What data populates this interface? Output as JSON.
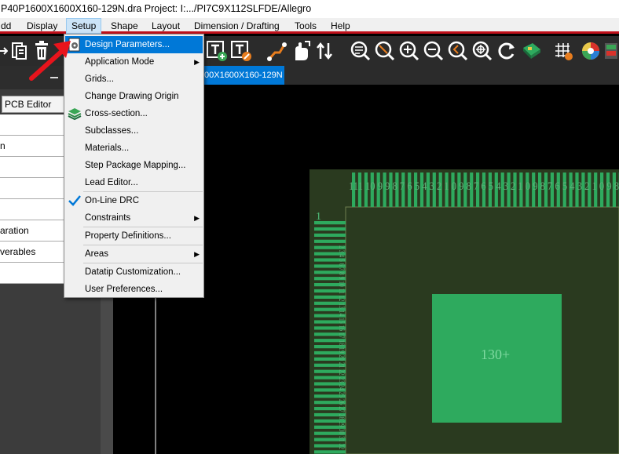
{
  "window": {
    "title": "P40P1600X1600X160-129N.dra  Project: I:.../PI7C9X112SLFDE/Allegro"
  },
  "menubar": {
    "items": [
      {
        "label": "dd"
      },
      {
        "label": "Display"
      },
      {
        "label": "Setup"
      },
      {
        "label": "Shape"
      },
      {
        "label": "Layout"
      },
      {
        "label": "Dimension / Drafting"
      },
      {
        "label": "Tools"
      },
      {
        "label": "Help"
      }
    ]
  },
  "tab": {
    "label": "00X1600X160-129N"
  },
  "left_panel": {
    "selector_value": "PCB Editor",
    "items": [
      "",
      "n",
      "",
      "",
      "",
      "aration",
      "verables",
      ""
    ]
  },
  "setup_menu": {
    "items": [
      {
        "label": "Design Parameters...",
        "highlighted": true,
        "icon": "design-parameters-icon"
      },
      {
        "label": "Application Mode",
        "submenu": true
      },
      {
        "label": "Grids..."
      },
      {
        "label": "Change Drawing Origin"
      },
      {
        "label": "Cross-section...",
        "icon": "cross-section-icon"
      },
      {
        "label": "Subclasses..."
      },
      {
        "label": "Materials..."
      },
      {
        "label": "Step Package Mapping..."
      },
      {
        "label": "Lead Editor..."
      },
      {
        "label": "On-Line DRC",
        "checked": true
      },
      {
        "label": "Constraints",
        "submenu": true
      },
      {
        "label": "Property Definitions..."
      },
      {
        "label": "Areas",
        "submenu": true
      },
      {
        "label": "Datatip Customization..."
      },
      {
        "label": "User Preferences..."
      }
    ]
  },
  "footprint": {
    "pin1_label": "1",
    "top_pin_labels": "111 10 9 9 8 7 6 5 4 3 2 1 0 9 8 7 6 5 4 3 2 1 0 9 8 7 6 5 4 3 2 1 0 9 8",
    "left_pin_labels": "2 3 4 5 6 7 8 9 10 11 12 13 14 15 16 17 18 19 20 21 22 23 24 25 26 27 28 29 30 31 32",
    "center_pad_label": "130+"
  },
  "colors": {
    "menu_highlight": "#0078d7",
    "accent_red": "#c0101a",
    "pad_green": "#2eaa5e",
    "board_fill": "#2a3a1f"
  }
}
